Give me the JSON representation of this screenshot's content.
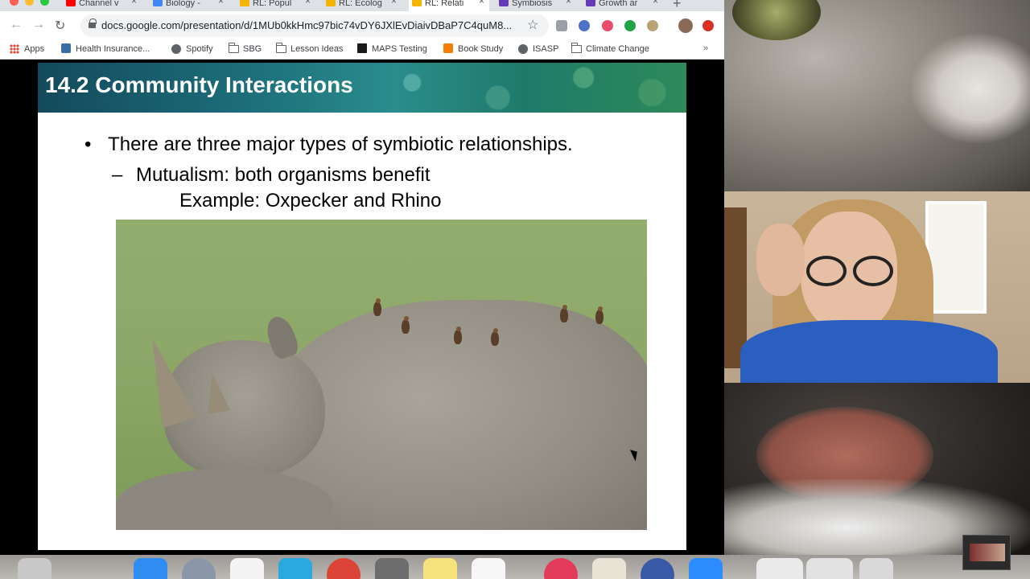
{
  "browser": {
    "tabs": [
      {
        "label": "Channel v",
        "favicon_color": "#ff0000",
        "active": false
      },
      {
        "label": "Biology - ",
        "favicon_color": "#4285f4",
        "active": false
      },
      {
        "label": "RL: Popul",
        "favicon_color": "#f4b400",
        "active": false
      },
      {
        "label": "RL: Ecolog",
        "favicon_color": "#f4b400",
        "active": false
      },
      {
        "label": "RL: Relati",
        "favicon_color": "#f4b400",
        "active": true
      },
      {
        "label": "Symbiosis",
        "favicon_color": "#673ab7",
        "active": false
      },
      {
        "label": "Growth ar",
        "favicon_color": "#673ab7",
        "active": false
      }
    ],
    "new_tab_label": "+",
    "url": "docs.google.com/presentation/d/1MUb0kkHmc97bic74vDY6JXlEvDiaivDBaP7C4quM8...",
    "bookmarks": [
      {
        "label": "Apps",
        "icon": "apps-grid-icon"
      },
      {
        "label": "Health Insurance...",
        "icon": "health-icon"
      },
      {
        "label": "Spotify",
        "icon": "globe-icon"
      },
      {
        "label": "SBG",
        "icon": "folder-icon"
      },
      {
        "label": "Lesson Ideas",
        "icon": "folder-icon"
      },
      {
        "label": "MAPS Testing",
        "icon": "maps-icon"
      },
      {
        "label": "Book Study",
        "icon": "blogger-icon"
      },
      {
        "label": "ISASP",
        "icon": "globe-icon"
      },
      {
        "label": "Climate Change",
        "icon": "folder-icon"
      }
    ],
    "more_label": "»"
  },
  "slide": {
    "title": "14.2 Community Interactions",
    "bullet": "There are three major types of symbiotic relationships.",
    "bullet_marker": "•",
    "sub_marker": "–",
    "sub_bullet": "Mutualism: both organisms benefit",
    "example": "Example: Oxpecker and Rhino"
  },
  "colors": {
    "banner": "#1c6b78",
    "shirt": "#2a5fc0"
  }
}
